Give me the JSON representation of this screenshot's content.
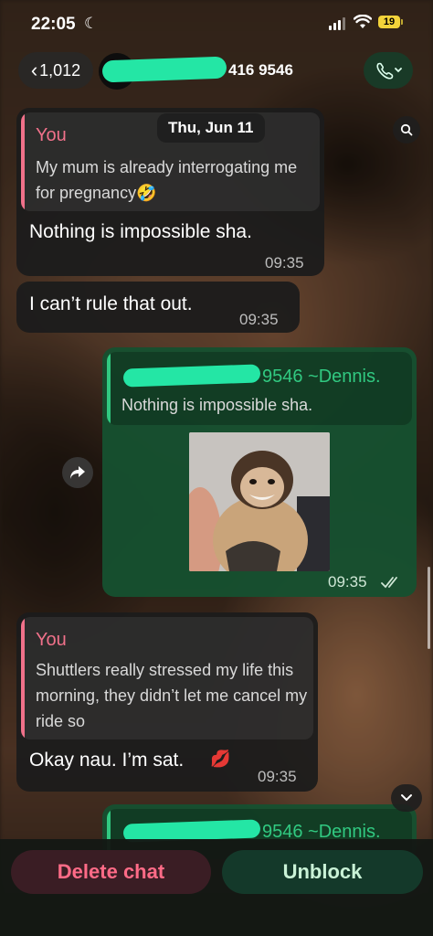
{
  "status_bar": {
    "time": "22:05",
    "battery": "19"
  },
  "header": {
    "back_count": "1,012",
    "contact_suffix": "416 9546"
  },
  "date_pill": "Thu, Jun 11",
  "messages": [
    {
      "quote_author": "You",
      "quote_text": "My mum is already interrogating me for pregnancy🤣",
      "text": "Nothing is impossible sha.",
      "time": "09:35"
    },
    {
      "text": "I can’t rule that out.",
      "time": "09:35"
    },
    {
      "quote_author_suffix": "9546 ~Dennis.",
      "quote_text": "Nothing is impossible sha.",
      "time": "09:35"
    },
    {
      "quote_author": "You",
      "quote_text": "Shuttlers really stressed my life this morning, they didn’t let me cancel my ride so",
      "text": "Okay nau. I’m sat.",
      "emoji": "💋",
      "time": "09:35"
    },
    {
      "quote_author_suffix": "9546 ~Dennis."
    }
  ],
  "actions": {
    "delete_label": "Delete chat",
    "unblock_label": "Unblock"
  },
  "colors": {
    "outgoing": "#165030",
    "incoming": "#1c1c1c",
    "quote_you": "#f0718a",
    "quote_them": "#31c981",
    "delete": "#ff6b87"
  }
}
